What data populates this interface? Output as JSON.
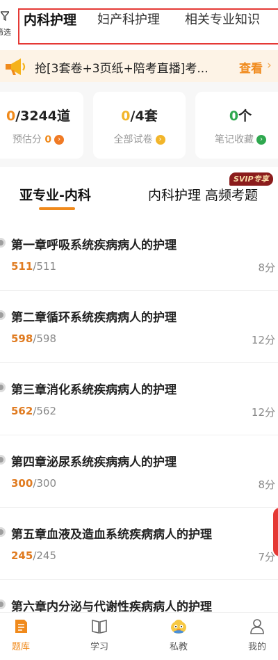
{
  "header": {
    "filter_label": "筛选",
    "tabs": [
      {
        "label": "内科护理",
        "active": true
      },
      {
        "label": "妇产科护理",
        "active": false
      },
      {
        "label": "相关专业知识",
        "active": false
      }
    ]
  },
  "notice": {
    "text": "抢[3套卷+3页纸+陪考直播]考...",
    "more_label": "查看",
    "arrow": "›"
  },
  "stats": [
    {
      "value": "0",
      "suffix": "/3244道",
      "label": "预估分",
      "label_value": "0",
      "accent": "#f08a1c"
    },
    {
      "value": "0",
      "suffix": "/4套",
      "label": "全部试卷",
      "label_value": "",
      "accent": "#f2b52a"
    },
    {
      "value": "0",
      "suffix": "个",
      "label": "笔记收藏",
      "label_value": "",
      "accent": "#2fa84f"
    }
  ],
  "subject_tabs": {
    "left": "亚专业-内科",
    "right": "内科护理 高频考题",
    "badge": "SVIP专享"
  },
  "chapters": [
    {
      "title": "第一章呼吸系统疾病病人的护理",
      "done": "511",
      "total": "/511",
      "score": "8分"
    },
    {
      "title": "第二章循环系统疾病病人的护理",
      "done": "598",
      "total": "/598",
      "score": "12分"
    },
    {
      "title": "第三章消化系统疾病病人的护理",
      "done": "562",
      "total": "/562",
      "score": "12分"
    },
    {
      "title": "第四章泌尿系统疾病病人的护理",
      "done": "300",
      "total": "/300",
      "score": "8分"
    },
    {
      "title": "第五章血液及造血系统疾病病人的护理",
      "done": "245",
      "total": "/245",
      "score": "7分"
    },
    {
      "title": "第六章内分泌与代谢性疾病病人的护理",
      "done": "",
      "total": "",
      "score": ""
    }
  ],
  "bottom_nav": [
    {
      "label": "题库",
      "icon": "question-bank-icon",
      "active": true
    },
    {
      "label": "学习",
      "icon": "book-icon",
      "active": false
    },
    {
      "label": "私教",
      "icon": "mascot-icon",
      "active": false
    },
    {
      "label": "我的",
      "icon": "profile-icon",
      "active": false
    }
  ],
  "colors": {
    "accent": "#f08a1c",
    "highlight_border": "#e53935",
    "svip": "#8b1c1c"
  }
}
